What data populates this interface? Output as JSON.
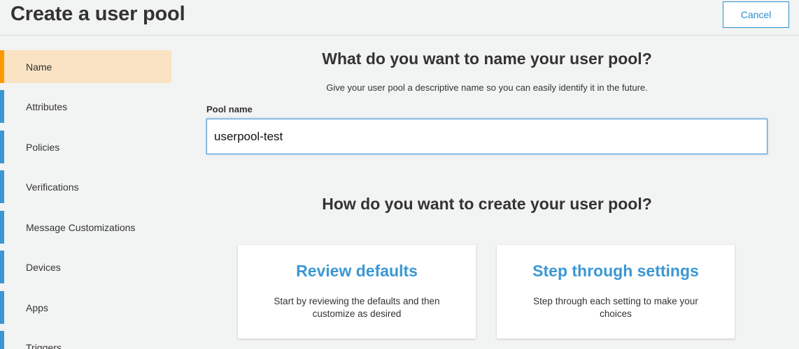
{
  "header": {
    "title": "Create a user pool",
    "cancel_label": "Cancel"
  },
  "sidebar": {
    "items": [
      {
        "label": "Name",
        "active": true
      },
      {
        "label": "Attributes",
        "active": false
      },
      {
        "label": "Policies",
        "active": false
      },
      {
        "label": "Verifications",
        "active": false
      },
      {
        "label": "Message Customizations",
        "active": false
      },
      {
        "label": "Devices",
        "active": false
      },
      {
        "label": "Apps",
        "active": false
      },
      {
        "label": "Triggers",
        "active": false
      }
    ]
  },
  "main": {
    "name_heading": "What do you want to name your user pool?",
    "name_description": "Give your user pool a descriptive name so you can easily identify it in the future.",
    "pool_name_label": "Pool name",
    "pool_name_value": "userpool-test",
    "create_heading": "How do you want to create your user pool?",
    "options": [
      {
        "title": "Review defaults",
        "description": "Start by reviewing the defaults and then customize as desired"
      },
      {
        "title": "Step through settings",
        "description": "Step through each setting to make your choices"
      }
    ]
  },
  "colors": {
    "accent_blue": "#3b97d3",
    "active_orange": "#ff9900",
    "active_bg": "#f9e3c3",
    "page_bg": "#f2f3f3"
  }
}
